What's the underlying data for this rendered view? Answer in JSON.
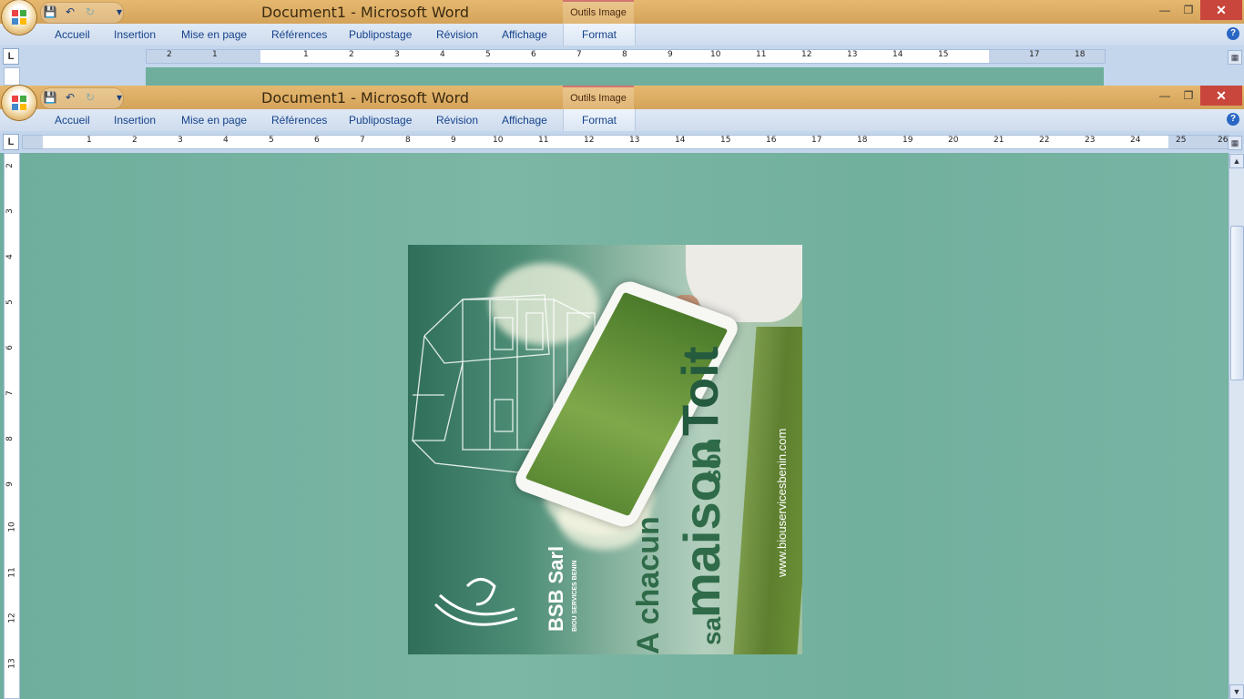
{
  "app": {
    "title": "Document1  -  Microsoft Word",
    "contextual_tab": "Outils Image"
  },
  "ribbon": {
    "tabs": [
      "Accueil",
      "Insertion",
      "Mise en page",
      "Références",
      "Publipostage",
      "Révision",
      "Affichage",
      "Format"
    ]
  },
  "ruler_top": {
    "numbers_back": [
      "2",
      "1",
      "1",
      "2",
      "3",
      "4",
      "5",
      "6",
      "7",
      "8",
      "9",
      "10",
      "11",
      "12",
      "13",
      "14",
      "15",
      "17",
      "18"
    ],
    "numbers_front": [
      "1",
      "2",
      "3",
      "4",
      "5",
      "6",
      "7",
      "8",
      "9",
      "10",
      "11",
      "12",
      "13",
      "14",
      "15",
      "16",
      "17",
      "18",
      "19",
      "20",
      "21",
      "22",
      "23",
      "24",
      "25",
      "26"
    ]
  },
  "ruler_left": {
    "numbers": [
      "2",
      "3",
      "4",
      "5",
      "6",
      "7",
      "8",
      "9",
      "10",
      "11",
      "12",
      "13"
    ]
  },
  "image": {
    "brand": "BSB Sarl",
    "brand_sub": "BIOU SERVICES BENIN",
    "slogan_1": "A chacun",
    "slogan_2": "sa",
    "slogan_3": "maison",
    "slogan_4": "son",
    "slogan_5": "Toit",
    "website": "www.biouservicesbenin.com"
  },
  "colors": {
    "title_bar": "#d9a95f",
    "ribbon": "#d6e3f2",
    "document_bg": "#72b09e",
    "close_button": "#c9463d"
  },
  "icons": [
    "office-button-icon",
    "save-icon",
    "undo-icon",
    "redo-icon",
    "customize-qat-icon",
    "minimize-icon",
    "restore-icon",
    "close-icon",
    "help-icon",
    "tab-selector-icon",
    "view-ruler-icon",
    "scroll-up-icon",
    "scroll-down-icon"
  ]
}
